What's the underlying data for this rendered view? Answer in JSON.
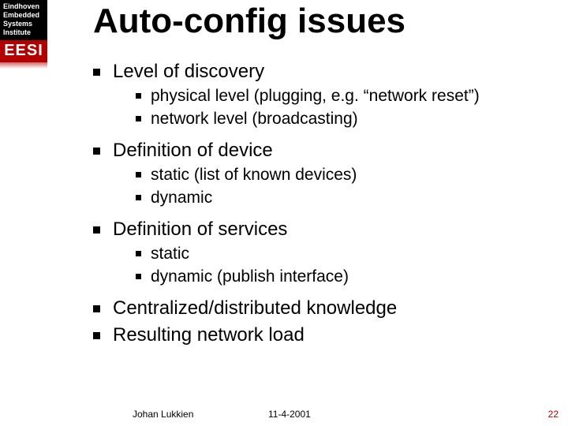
{
  "logo": {
    "line1": "Eindhoven",
    "line2": "Embedded",
    "line3": "Systems",
    "line4": "Institute",
    "acronym": "EESI"
  },
  "title": "Auto-config issues",
  "bullets": {
    "b1": "Level of discovery",
    "b1_1": "physical level (plugging, e.g. “network reset”)",
    "b1_2": "network level (broadcasting)",
    "b2": "Definition of device",
    "b2_1": "static (list of known devices)",
    "b2_2": "dynamic",
    "b3": "Definition of services",
    "b3_1": "static",
    "b3_2": "dynamic (publish interface)",
    "b4": "Centralized/distributed knowledge",
    "b5": "Resulting network load"
  },
  "footer": {
    "author": "Johan Lukkien",
    "date": "11-4-2001",
    "page": "22"
  }
}
